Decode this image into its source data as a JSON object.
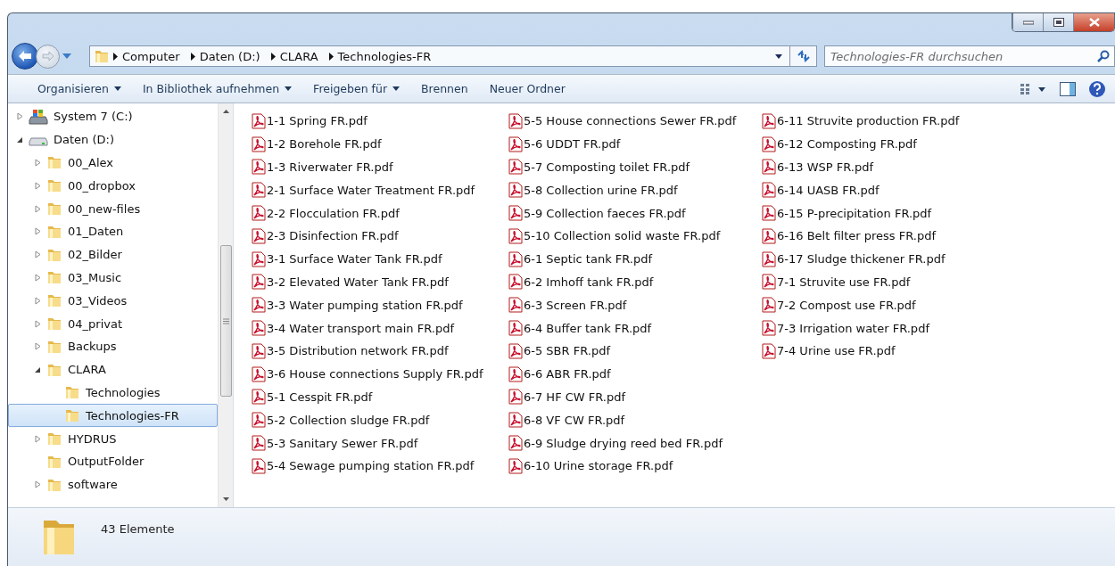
{
  "breadcrumb": [
    "Computer",
    "Daten (D:)",
    "CLARA",
    "Technologies-FR"
  ],
  "search": {
    "placeholder": "Technologies-FR durchsuchen"
  },
  "toolbar": [
    {
      "label": "Organisieren",
      "dropdown": true
    },
    {
      "label": "In Bibliothek aufnehmen",
      "dropdown": true
    },
    {
      "label": "Freigeben für",
      "dropdown": true
    },
    {
      "label": "Brennen",
      "dropdown": false
    },
    {
      "label": "Neuer Ordner",
      "dropdown": false
    }
  ],
  "tree": [
    {
      "label": "System 7 (C:)",
      "kind": "system-drive",
      "expandable": true,
      "expanded": false,
      "selected": false
    },
    {
      "label": "Daten (D:)",
      "kind": "drive",
      "expandable": true,
      "expanded": true,
      "selected": false,
      "children": [
        {
          "label": "00_Alex",
          "kind": "folder",
          "expandable": true,
          "expanded": false,
          "selected": false
        },
        {
          "label": "00_dropbox",
          "kind": "folder",
          "expandable": true,
          "expanded": false,
          "selected": false
        },
        {
          "label": "00_new-files",
          "kind": "folder",
          "expandable": true,
          "expanded": false,
          "selected": false
        },
        {
          "label": "01_Daten",
          "kind": "folder",
          "expandable": true,
          "expanded": false,
          "selected": false
        },
        {
          "label": "02_Bilder",
          "kind": "folder",
          "expandable": true,
          "expanded": false,
          "selected": false
        },
        {
          "label": "03_Music",
          "kind": "folder",
          "expandable": true,
          "expanded": false,
          "selected": false
        },
        {
          "label": "03_Videos",
          "kind": "folder",
          "expandable": true,
          "expanded": false,
          "selected": false
        },
        {
          "label": "04_privat",
          "kind": "folder",
          "expandable": true,
          "expanded": false,
          "selected": false
        },
        {
          "label": "Backups",
          "kind": "folder",
          "expandable": true,
          "expanded": false,
          "selected": false
        },
        {
          "label": "CLARA",
          "kind": "folder",
          "expandable": true,
          "expanded": true,
          "selected": false,
          "children": [
            {
              "label": "Technologies",
              "kind": "folder",
              "expandable": false,
              "selected": false
            },
            {
              "label": "Technologies-FR",
              "kind": "folder",
              "expandable": false,
              "selected": true
            }
          ]
        },
        {
          "label": "HYDRUS",
          "kind": "folder",
          "expandable": true,
          "expanded": false,
          "selected": false
        },
        {
          "label": "OutputFolder",
          "kind": "folder",
          "expandable": false,
          "selected": false
        },
        {
          "label": "software",
          "kind": "folder",
          "expandable": true,
          "expanded": false,
          "selected": false
        }
      ]
    }
  ],
  "files": [
    "1-1 Spring FR.pdf",
    "1-2 Borehole FR.pdf",
    "1-3 Riverwater FR.pdf",
    "2-1 Surface Water Treatment FR.pdf",
    "2-2 Flocculation FR.pdf",
    "2-3 Disinfection FR.pdf",
    "3-1 Surface Water Tank FR.pdf",
    "3-2 Elevated Water Tank FR.pdf",
    "3-3 Water pumping station FR.pdf",
    "3-4 Water transport main FR.pdf",
    "3-5 Distribution network FR.pdf",
    "3-6 House connections Supply FR.pdf",
    "5-1 Cesspit FR.pdf",
    "5-2 Collection sludge FR.pdf",
    "5-3 Sanitary Sewer FR.pdf",
    "5-4 Sewage pumping station FR.pdf",
    "5-5 House connections Sewer FR.pdf",
    "5-6 UDDT FR.pdf",
    "5-7 Composting toilet FR.pdf",
    "5-8 Collection urine FR.pdf",
    "5-9 Collection faeces FR.pdf",
    "5-10 Collection solid waste FR.pdf",
    "6-1 Septic tank FR.pdf",
    "6-2 Imhoff tank FR.pdf",
    "6-3 Screen FR.pdf",
    "6-4 Buffer tank FR.pdf",
    "6-5 SBR  FR.pdf",
    "6-6 ABR FR.pdf",
    "6-7 HF CW FR.pdf",
    "6-8 VF CW  FR.pdf",
    "6-9 Sludge drying reed bed FR.pdf",
    "6-10 Urine storage FR.pdf",
    "6-11 Struvite production FR.pdf",
    "6-12 Composting FR.pdf",
    "6-13 WSP FR.pdf",
    "6-14 UASB FR.pdf",
    "6-15 P-precipitation FR.pdf",
    "6-16 Belt filter press FR.pdf",
    "6-17 Sludge thickener FR.pdf",
    "7-1 Struvite use FR.pdf",
    "7-2 Compost use FR.pdf",
    "7-3 Irrigation water FR.pdf",
    "7-4 Urine use FR.pdf"
  ],
  "status": {
    "count": "43 Elemente"
  }
}
